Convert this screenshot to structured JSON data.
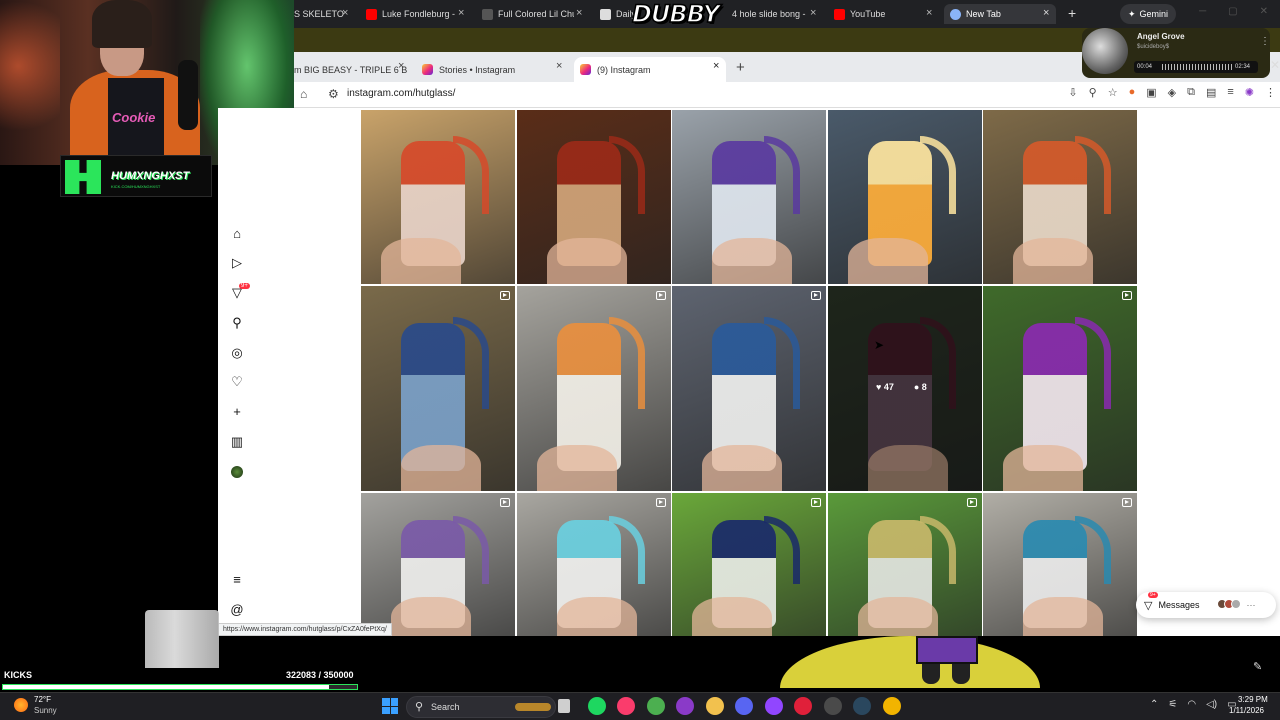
{
  "browser_top": {
    "tabs": [
      {
        "label": "S SKELETO",
        "color": "#888"
      },
      {
        "label": "Luke Fondleburg -",
        "color": "#ff0000"
      },
      {
        "label": "Full Colored Lil Chu",
        "color": "#555"
      },
      {
        "label": "Daily",
        "color": "#ddd"
      },
      {
        "label": "4 hole slide bong -",
        "color": "#888"
      },
      {
        "label": "YouTube",
        "color": "#ff0000"
      },
      {
        "label": "New Tab",
        "color": "#8ab4f8"
      }
    ],
    "new_tab": "+",
    "gemini_label": "Gemini",
    "stream_logo": "DUBBY"
  },
  "browser_second": {
    "tabs": [
      {
        "label": "m BIG BEASY - TRIPLE 6 B"
      },
      {
        "label": "Stories • Instagram"
      },
      {
        "label": "(9) Instagram"
      }
    ],
    "new_tab": "+",
    "url": "instagram.com/hutglass/"
  },
  "music_player": {
    "title": "Angel Grove",
    "artist": "$uicideboy$",
    "current_time": "00:04",
    "duration": "02:34"
  },
  "instagram": {
    "nav": {
      "notifications_badge": "9+",
      "icons": [
        "home-icon",
        "reels-icon",
        "messenger-icon",
        "search-icon",
        "explore-icon",
        "heart-icon",
        "create-icon",
        "dashboard-icon",
        "profile-icon",
        "menu-icon",
        "threads-icon"
      ]
    },
    "hover_post": {
      "likes": "47",
      "comments": "8"
    },
    "messages": {
      "label": "Messages",
      "badge": "9+"
    },
    "posts": [
      {
        "bg": "#c9a36a",
        "glass": "#e8d3c8",
        "accent": "#d64a2a",
        "reel": false
      },
      {
        "bg": "#5a2d18",
        "glass": "#d2a57a",
        "accent": "#9b2a18",
        "reel": false
      },
      {
        "bg": "#9aa2aa",
        "glass": "#dfe6ee",
        "accent": "#5a3aa0",
        "reel": false
      },
      {
        "bg": "#4a5a6a",
        "glass": "#ffae3a",
        "accent": "#ffe6a0",
        "reel": false
      },
      {
        "bg": "#7e6a48",
        "glass": "#e9d9c8",
        "accent": "#d55a2a",
        "reel": false
      },
      {
        "bg": "#7a6a4a",
        "glass": "#7aa0c8",
        "accent": "#2a4a8a",
        "reel": true
      },
      {
        "bg": "#a5a39d",
        "glass": "#f2efe7",
        "accent": "#e98f3e",
        "reel": true
      },
      {
        "bg": "#5e6470",
        "glass": "#eff0ee",
        "accent": "#2a5a9a",
        "reel": true
      },
      {
        "bg": "#2e3a2a",
        "glass": "#6a5060",
        "accent": "#4a1a2a",
        "reel": false
      },
      {
        "bg": "#3f6a2a",
        "glass": "#f2e6ee",
        "accent": "#8a2ab0",
        "reel": true
      },
      {
        "bg": "#a3a29e",
        "glass": "#eeeeec",
        "accent": "#7a5aa8",
        "reel": true
      },
      {
        "bg": "#a9a7a1",
        "glass": "#f0f0ee",
        "accent": "#6ad0e0",
        "reel": true
      },
      {
        "bg": "#6aa83a",
        "glass": "#e8ebe5",
        "accent": "#1a2a6a",
        "reel": true
      },
      {
        "bg": "#5a9a3a",
        "glass": "#e3e5e0",
        "accent": "#c8b86a",
        "reel": true
      },
      {
        "bg": "#b1aea6",
        "glass": "#eaeaea",
        "accent": "#2a8ab0",
        "reel": true
      }
    ]
  },
  "status_url": "https://www.instagram.com/hutglass/p/CxZA0fePtXq/",
  "stream_overlay": {
    "brand_name": "HUMXNGHXST",
    "brand_url": "KICK.COM/HUMXNGHXST",
    "shirt_text": "Cookie",
    "kicks_label": "KICKS",
    "kicks_count": "322083 / 350000",
    "kicks_progress": 0.92
  },
  "taskbar": {
    "weather_temp": "72°F",
    "weather_cond": "Sunny",
    "search_label": "Search",
    "time": "3:29 PM",
    "date": "1/11/2026",
    "apps": [
      {
        "name": "task-view-icon",
        "color": "#cfcfcf"
      },
      {
        "name": "spotify-icon",
        "color": "#1ed760"
      },
      {
        "name": "itunes-icon",
        "color": "#fa3c6c"
      },
      {
        "name": "chrome-icon",
        "color": "#4caf50"
      },
      {
        "name": "app-purple-icon",
        "color": "#8a3ac8"
      },
      {
        "name": "file-explorer-icon",
        "color": "#f2c14e"
      },
      {
        "name": "discord-icon",
        "color": "#5865f2"
      },
      {
        "name": "twitch-icon",
        "color": "#9146ff"
      },
      {
        "name": "app-red-icon",
        "color": "#e0203a"
      },
      {
        "name": "obs-icon",
        "color": "#4a4a4a"
      },
      {
        "name": "steam-icon",
        "color": "#2a475e"
      },
      {
        "name": "chrome-canary-icon",
        "color": "#f2b400"
      }
    ]
  }
}
